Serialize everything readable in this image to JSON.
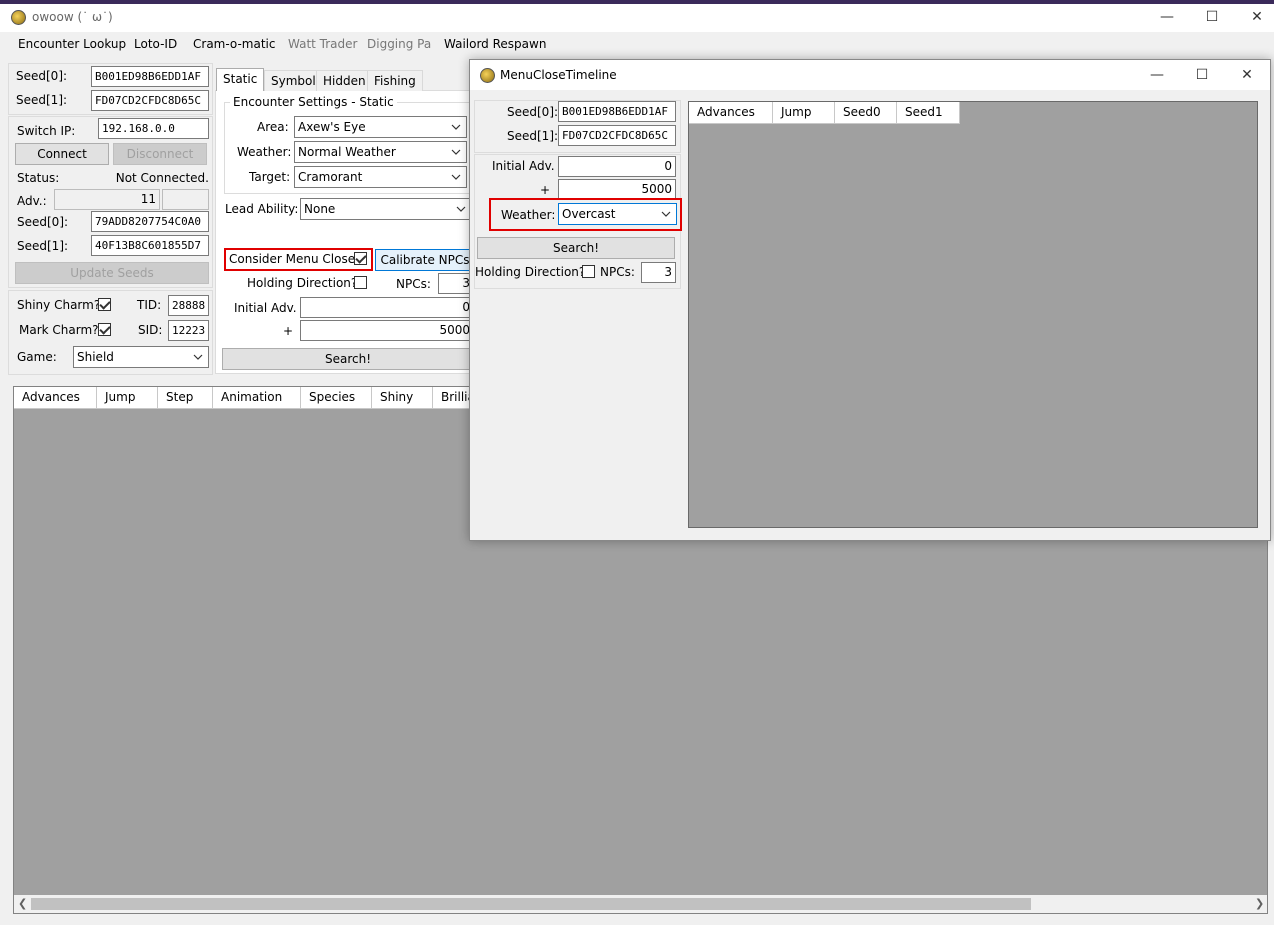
{
  "browser_tabs": [
    "...",
    "...",
    "...",
    "..."
  ],
  "main_window": {
    "title": "owoow (˙ ω˙)",
    "menu": [
      "Encounter Lookup",
      "Loto-ID",
      "Cram-o-matic",
      "Watt Trader",
      "Digging Pa",
      "Wailord Respawn"
    ],
    "seed0_label": "Seed[0]:",
    "seed0_value": "B001ED98B6EDD1AF",
    "seed1_label": "Seed[1]:",
    "seed1_value": "FD07CD2CFDC8D65C",
    "switch_ip_label": "Switch IP:",
    "switch_ip_value": "192.168.0.0",
    "connect": "Connect",
    "disconnect": "Disconnect",
    "status_label": "Status:",
    "status_value": "Not Connected.",
    "adv_label": "Adv.:",
    "adv_value": "11",
    "cur_seed0_label": "Seed[0]:",
    "cur_seed0_value": "79ADD8207754C0A0",
    "cur_seed1_label": "Seed[1]:",
    "cur_seed1_value": "40F13B8C601855D7",
    "update_seeds": "Update Seeds",
    "shiny_charm": "Shiny Charm?",
    "mark_charm": "Mark Charm?",
    "tid_label": "TID:",
    "tid_value": "28888",
    "sid_label": "SID:",
    "sid_value": "12223",
    "game_label": "Game:",
    "game_value": "Shield",
    "tabs": [
      "Static",
      "Symbol",
      "Hidden",
      "Fishing"
    ],
    "group_title": "Encounter Settings - Static",
    "area_label": "Area:",
    "area_value": "Axew's Eye",
    "weather_label": "Weather:",
    "weather_value": "Normal Weather",
    "target_label": "Target:",
    "target_value": "Cramorant",
    "lead_label": "Lead Ability:",
    "lead_value": "None",
    "consider_menu_close": "Consider Menu Close?",
    "calibrate_npcs": "Calibrate NPCs",
    "holding_direction": "Holding Direction?",
    "npcs_label": "NPCs:",
    "npcs_value": "3",
    "initial_adv_label": "Initial Adv.",
    "initial_adv_value": "0",
    "plus_label": "+",
    "plus_value": "5000",
    "search": "Search!",
    "columns": [
      "Advances",
      "Jump",
      "Step",
      "Animation",
      "Species",
      "Shiny",
      "Brillia"
    ]
  },
  "dialog": {
    "title": "MenuCloseTimeline",
    "seed0_label": "Seed[0]:",
    "seed0_value": "B001ED98B6EDD1AF",
    "seed1_label": "Seed[1]:",
    "seed1_value": "FD07CD2CFDC8D65C",
    "initial_adv_label": "Initial Adv.",
    "initial_adv_value": "0",
    "plus_label": "+",
    "plus_value": "5000",
    "weather_label": "Weather:",
    "weather_value": "Overcast",
    "search": "Search!",
    "holding_direction": "Holding Direction?",
    "npcs_label": "NPCs:",
    "npcs_value": "3",
    "columns": [
      "Advances",
      "Jump",
      "Seed0",
      "Seed1"
    ]
  },
  "colors": {
    "highlight": "#e00000",
    "grid_bg": "#a0a0a0",
    "accent": "#0078d7"
  }
}
